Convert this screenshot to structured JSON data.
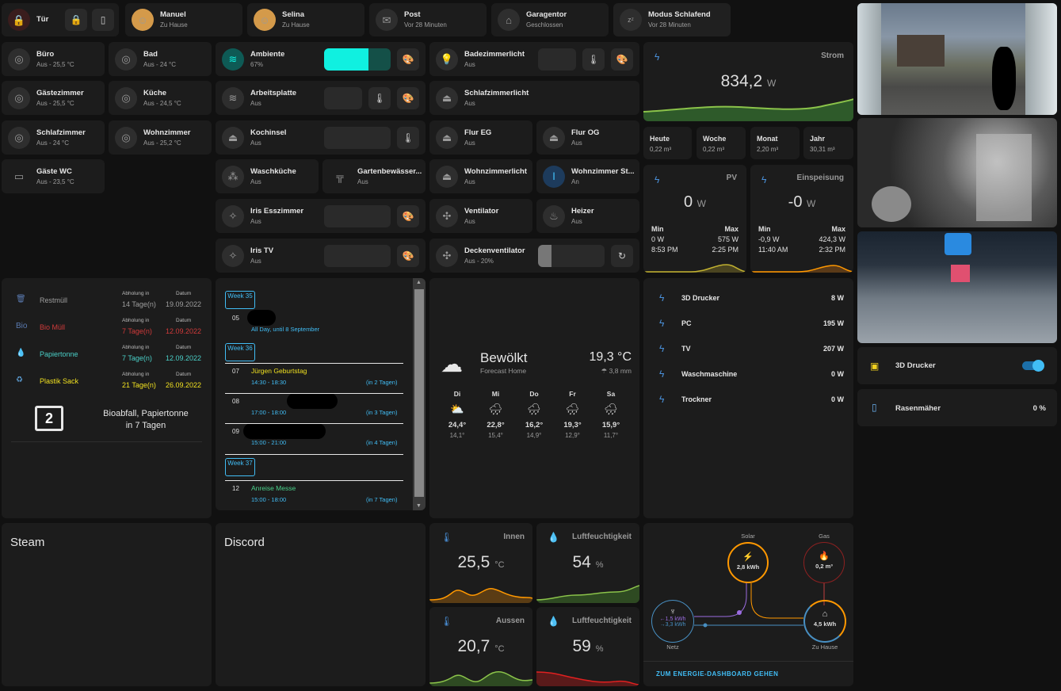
{
  "top": [
    {
      "name": "Tür",
      "status": "",
      "icon": "door-lock-icon"
    },
    {
      "name": "Manuel",
      "status": "Zu Hause",
      "icon": "avatar"
    },
    {
      "name": "Selina",
      "status": "Zu Hause",
      "icon": "avatar"
    },
    {
      "name": "Post",
      "status": "Vor 28 Minuten",
      "icon": "mail-icon"
    },
    {
      "name": "Garagentor",
      "status": "Geschlossen",
      "icon": "garage-icon"
    },
    {
      "name": "Modus Schlafend",
      "status": "Vor 28 Minuten",
      "icon": "sleep-icon"
    }
  ],
  "rooms": [
    {
      "name": "Büro",
      "status": "Aus - 25,5 °C"
    },
    {
      "name": "Bad",
      "status": "Aus - 24 °C"
    },
    {
      "name": "Gästezimmer",
      "status": "Aus - 25,5 °C"
    },
    {
      "name": "Küche",
      "status": "Aus - 24,5 °C"
    },
    {
      "name": "Schlafzimmer",
      "status": "Aus - 24 °C"
    },
    {
      "name": "Wohnzimmer",
      "status": "Aus - 25,2 °C"
    },
    {
      "name": "Gäste WC",
      "status": "Aus - 23,5 °C"
    }
  ],
  "lights": [
    {
      "name": "Ambiente",
      "status": "67%"
    },
    {
      "name": "Arbeitsplatte",
      "status": "Aus"
    },
    {
      "name": "Kochinsel",
      "status": "Aus"
    },
    {
      "name": "Waschküche",
      "status": "Aus"
    },
    {
      "name": "Gartenbewässer...",
      "status": "Aus"
    },
    {
      "name": "Iris Esszimmer",
      "status": "Aus"
    },
    {
      "name": "Iris TV",
      "status": "Aus"
    },
    {
      "name": "Badezimmerlicht",
      "status": "Aus"
    },
    {
      "name": "Schlafzimmerlicht",
      "status": "Aus"
    },
    {
      "name": "Flur EG",
      "status": "Aus"
    },
    {
      "name": "Flur OG",
      "status": "Aus"
    },
    {
      "name": "Wohnzimmerlicht",
      "status": "Aus"
    },
    {
      "name": "Wohnzimmer St...",
      "status": "An"
    },
    {
      "name": "Ventilator",
      "status": "Aus"
    },
    {
      "name": "Heizer",
      "status": "Aus"
    },
    {
      "name": "Deckenventilator",
      "status": "Aus - 20%"
    }
  ],
  "ambiente_brightness": 0.67,
  "deckenventilator_level": 0.2,
  "strom": {
    "title": "Strom",
    "value": "834,2",
    "unit": "W"
  },
  "periods": [
    {
      "label": "Heute",
      "value": "0,22 m³"
    },
    {
      "label": "Woche",
      "value": "0,22 m³"
    },
    {
      "label": "Monat",
      "value": "2,20 m³"
    },
    {
      "label": "Jahr",
      "value": "30,31 m³"
    }
  ],
  "pv": {
    "title": "PV",
    "value": "0",
    "unit": "W",
    "min_label": "Min",
    "max_label": "Max",
    "min": "0 W",
    "max": "575 W",
    "min_time": "8:53 PM",
    "max_time": "2:25 PM"
  },
  "einspeisung": {
    "title": "Einspeisung",
    "value": "-0",
    "unit": "W",
    "min_label": "Min",
    "max_label": "Max",
    "min": "-0,9 W",
    "max": "424,3 W",
    "min_time": "11:40 AM",
    "max_time": "2:32 PM"
  },
  "waste": {
    "col1": "Abholung in",
    "col2": "Datum",
    "items": [
      {
        "name": "Restmüll",
        "in": "14 Tage(n)",
        "date": "19.09.2022",
        "color": "#9e9e9e"
      },
      {
        "name": "Bio Müll",
        "in": "7 Tage(n)",
        "date": "12.09.2022",
        "color": "#d03a3a"
      },
      {
        "name": "Papiertonne",
        "in": "7 Tage(n)",
        "date": "12.09.2022",
        "color": "#4ad0c8"
      },
      {
        "name": "Plastik Sack",
        "in": "21 Tage(n)",
        "date": "26.09.2022",
        "color": "#f0e020"
      }
    ],
    "bio_label": "Bio",
    "badge": "2",
    "summary1": "Bioabfall, Papiertonne",
    "summary2": "in 7 Tagen"
  },
  "calendar": {
    "week35": "Week 35",
    "week36": "Week 36",
    "week37": "Week 37",
    "events": [
      {
        "day": "05",
        "title": "",
        "time": "All Day, until 8 September",
        "rel": ""
      },
      {
        "day": "07",
        "title": "Jürgen Geburtstag",
        "time": "14:30 - 18:30",
        "rel": "(in 2 Tagen)"
      },
      {
        "day": "08",
        "title": "",
        "time": "17:00 - 18:00",
        "rel": "(in 3 Tagen)"
      },
      {
        "day": "09",
        "title": "",
        "time": "15:00 - 21:00",
        "rel": "(in 4 Tagen)"
      },
      {
        "day": "12",
        "title": "Anreise Messe",
        "time": "15:00 - 18:00",
        "rel": "(in 7 Tagen)"
      }
    ]
  },
  "weather": {
    "cond": "Bewölkt",
    "sub": "Forecast Home",
    "temp": "19,3 °C",
    "rain": "3,8 mm",
    "days": [
      {
        "d": "Di",
        "hi": "24,4°",
        "lo": "14,1°"
      },
      {
        "d": "Mi",
        "hi": "22,8°",
        "lo": "15,4°"
      },
      {
        "d": "Do",
        "hi": "16,2°",
        "lo": "14,9°"
      },
      {
        "d": "Fr",
        "hi": "19,3°",
        "lo": "12,9°"
      },
      {
        "d": "Sa",
        "hi": "15,9°",
        "lo": "11,7°"
      }
    ]
  },
  "power": [
    {
      "name": "3D Drucker",
      "value": "8 W"
    },
    {
      "name": "PC",
      "value": "195 W"
    },
    {
      "name": "TV",
      "value": "207 W"
    },
    {
      "name": "Waschmaschine",
      "value": "0 W"
    },
    {
      "name": "Trockner",
      "value": "0 W"
    }
  ],
  "right": {
    "printer": "3D Drucker",
    "mower": "Rasenmäher",
    "mower_val": "0 %"
  },
  "steam": "Steam",
  "discord": "Discord",
  "sensors": [
    {
      "title": "Innen",
      "value": "25,5",
      "unit": "°C"
    },
    {
      "title": "Luftfeuchtigkeit",
      "value": "54",
      "unit": "%"
    },
    {
      "title": "Aussen",
      "value": "20,7",
      "unit": "°C"
    },
    {
      "title": "Luftfeuchtigkeit",
      "value": "59",
      "unit": "%"
    }
  ],
  "energy": {
    "solar": "Solar",
    "solar_val": "2,8 kWh",
    "gas": "Gas",
    "gas_val": "0,2 m³",
    "netz": "Netz",
    "netz_in": "←1,5 kWh",
    "netz_out": "→3,3 kWh",
    "home": "Zu Hause",
    "home_val": "4,5 kWh",
    "link": "ZUM ENERGIE-DASHBOARD GEHEN"
  },
  "colors": {
    "accent": "#41bdf5",
    "ambiente": "#10f0e0",
    "solar": "#ff9800",
    "gas": "#8e2121",
    "grid": "#488fc2",
    "home": "#ff9800"
  }
}
